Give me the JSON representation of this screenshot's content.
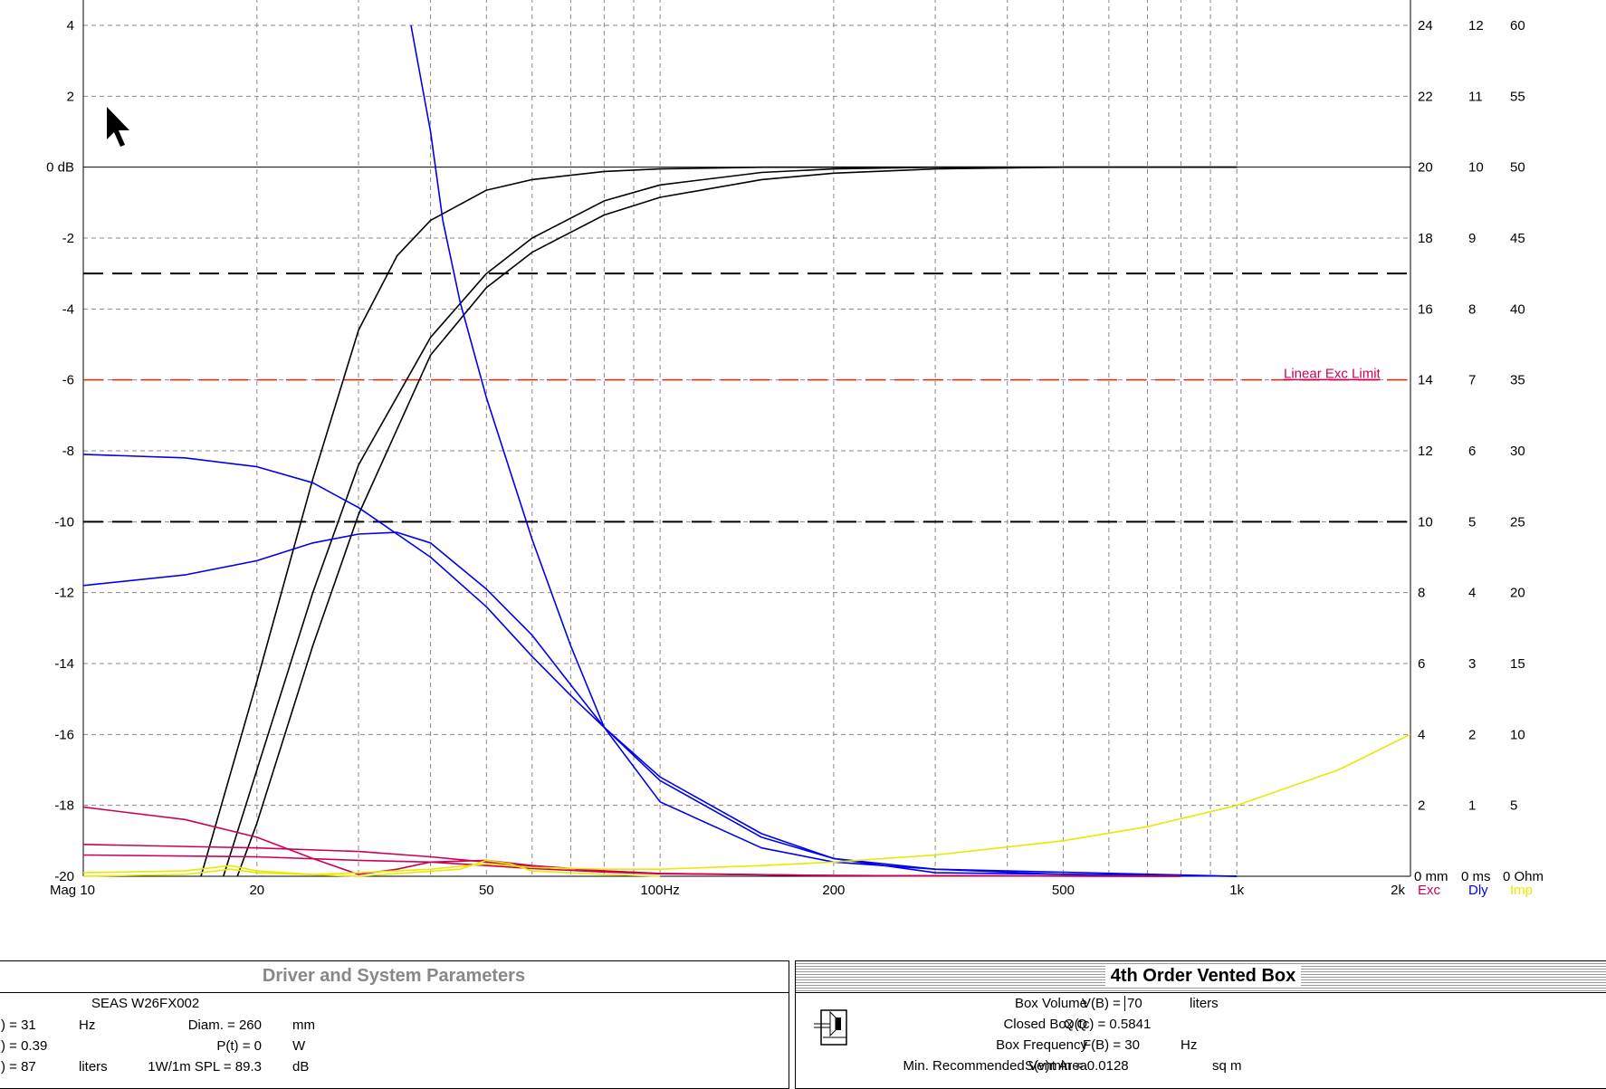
{
  "chart_data": {
    "type": "line",
    "xscale": "log",
    "xlim": [
      10,
      2000
    ],
    "x_ticks": [
      {
        "v": 10,
        "label": "Mag 10"
      },
      {
        "v": 20,
        "label": "20"
      },
      {
        "v": 50,
        "label": "50"
      },
      {
        "v": 100,
        "label": "100Hz"
      },
      {
        "v": 200,
        "label": "200"
      },
      {
        "v": 500,
        "label": "500"
      },
      {
        "v": 1000,
        "label": "1k"
      },
      {
        "v": 2000,
        "label": "2k"
      }
    ],
    "ylim": [
      -20,
      4
    ],
    "y_ticks": [
      {
        "v": 4,
        "label": "4"
      },
      {
        "v": 2,
        "label": "2"
      },
      {
        "v": 0,
        "label": "0 dB"
      },
      {
        "v": -2,
        "label": "-2"
      },
      {
        "v": -4,
        "label": "-4"
      },
      {
        "v": -6,
        "label": "-6"
      },
      {
        "v": -8,
        "label": "-8"
      },
      {
        "v": -10,
        "label": "-10"
      },
      {
        "v": -12,
        "label": "-12"
      },
      {
        "v": -14,
        "label": "-14"
      },
      {
        "v": -16,
        "label": "-16"
      },
      {
        "v": -18,
        "label": "-18"
      },
      {
        "v": -20,
        "label": "-20"
      }
    ],
    "right_axes": [
      {
        "name": "Exc",
        "unit": "mm",
        "color": "#cc0055",
        "labels": [
          "24",
          "22",
          "20",
          "18",
          "16",
          "14",
          "12",
          "10",
          "8",
          "6",
          "4",
          "2",
          "0 mm"
        ]
      },
      {
        "name": "Dly",
        "unit": "ms",
        "color": "#0000ee",
        "labels": [
          "12",
          "11",
          "10",
          "9",
          "8",
          "7",
          "6",
          "5",
          "4",
          "3",
          "2",
          "1",
          "0 ms"
        ]
      },
      {
        "name": "Imp",
        "unit": "Ohm",
        "color": "#e8e800",
        "labels": [
          "60",
          "55",
          "50",
          "45",
          "40",
          "35",
          "30",
          "25",
          "20",
          "15",
          "10",
          "5",
          "0 Ohm"
        ]
      }
    ],
    "reference_lines": [
      {
        "y": -3,
        "style": "dash",
        "color": "#000000"
      },
      {
        "y": -10,
        "style": "dash",
        "color": "#000000"
      },
      {
        "y": -6,
        "style": "dash",
        "color": "#ee2200",
        "label": "Linear Exc Limit"
      }
    ],
    "series": [
      {
        "kind": "magnitude",
        "color": "#000000",
        "points": [
          [
            16,
            -20
          ],
          [
            20,
            -14.5
          ],
          [
            25,
            -8.8
          ],
          [
            30,
            -4.6
          ],
          [
            35,
            -2.5
          ],
          [
            40,
            -1.5
          ],
          [
            50,
            -0.65
          ],
          [
            60,
            -0.35
          ],
          [
            80,
            -0.12
          ],
          [
            100,
            -0.05
          ],
          [
            150,
            0
          ],
          [
            1000,
            0
          ]
        ]
      },
      {
        "kind": "magnitude",
        "color": "#000000",
        "points": [
          [
            17.5,
            -20
          ],
          [
            20,
            -17
          ],
          [
            25,
            -12
          ],
          [
            30,
            -8.4
          ],
          [
            40,
            -4.8
          ],
          [
            50,
            -3.0
          ],
          [
            60,
            -2.0
          ],
          [
            80,
            -0.95
          ],
          [
            100,
            -0.5
          ],
          [
            150,
            -0.15
          ],
          [
            200,
            -0.05
          ],
          [
            300,
            0
          ],
          [
            1000,
            0
          ]
        ]
      },
      {
        "kind": "magnitude",
        "color": "#000000",
        "points": [
          [
            18.5,
            -20
          ],
          [
            20,
            -18.5
          ],
          [
            25,
            -13.5
          ],
          [
            30,
            -9.8
          ],
          [
            40,
            -5.3
          ],
          [
            50,
            -3.4
          ],
          [
            60,
            -2.4
          ],
          [
            80,
            -1.35
          ],
          [
            100,
            -0.85
          ],
          [
            150,
            -0.35
          ],
          [
            200,
            -0.17
          ],
          [
            300,
            -0.05
          ],
          [
            500,
            0
          ],
          [
            1000,
            0
          ]
        ]
      },
      {
        "kind": "group_delay",
        "color": "#0000ee",
        "points": [
          [
            37,
            4
          ],
          [
            40,
            1
          ],
          [
            42,
            -1.5
          ],
          [
            45,
            -3.8
          ],
          [
            50,
            -6.5
          ],
          [
            60,
            -10.5
          ],
          [
            70,
            -13.5
          ],
          [
            80,
            -15.8
          ],
          [
            100,
            -17.9
          ],
          [
            150,
            -19.2
          ],
          [
            200,
            -19.6
          ],
          [
            300,
            -19.8
          ],
          [
            500,
            -19.95
          ],
          [
            1000,
            -20
          ]
        ]
      },
      {
        "kind": "group_delay",
        "color": "#0000ee",
        "points": [
          [
            10,
            -8.1
          ],
          [
            15,
            -8.2
          ],
          [
            20,
            -8.45
          ],
          [
            25,
            -8.9
          ],
          [
            30,
            -9.6
          ],
          [
            40,
            -11.0
          ],
          [
            50,
            -12.4
          ],
          [
            60,
            -13.8
          ],
          [
            70,
            -14.9
          ],
          [
            80,
            -15.8
          ],
          [
            100,
            -17.2
          ],
          [
            150,
            -18.8
          ],
          [
            200,
            -19.5
          ],
          [
            300,
            -19.9
          ],
          [
            1000,
            -20
          ]
        ]
      },
      {
        "kind": "group_delay",
        "color": "#0000ee",
        "points": [
          [
            10,
            -11.8
          ],
          [
            15,
            -11.5
          ],
          [
            20,
            -11.1
          ],
          [
            25,
            -10.6
          ],
          [
            30,
            -10.35
          ],
          [
            35,
            -10.3
          ],
          [
            40,
            -10.6
          ],
          [
            50,
            -11.9
          ],
          [
            60,
            -13.2
          ],
          [
            70,
            -14.6
          ],
          [
            80,
            -15.8
          ],
          [
            100,
            -17.3
          ],
          [
            150,
            -18.9
          ],
          [
            200,
            -19.5
          ],
          [
            300,
            -19.8
          ],
          [
            1000,
            -20
          ]
        ]
      },
      {
        "kind": "excursion",
        "color": "#cc0055",
        "points": [
          [
            10,
            -18.05
          ],
          [
            15,
            -18.4
          ],
          [
            20,
            -18.9
          ],
          [
            25,
            -19.5
          ],
          [
            30,
            -19.95
          ],
          [
            35,
            -19.8
          ],
          [
            40,
            -19.6
          ],
          [
            50,
            -19.55
          ],
          [
            60,
            -19.7
          ],
          [
            80,
            -19.85
          ],
          [
            100,
            -19.92
          ],
          [
            200,
            -19.98
          ],
          [
            800,
            -20
          ]
        ]
      },
      {
        "kind": "excursion",
        "color": "#cc0055",
        "points": [
          [
            10,
            -19.1
          ],
          [
            20,
            -19.2
          ],
          [
            30,
            -19.3
          ],
          [
            40,
            -19.45
          ],
          [
            50,
            -19.6
          ],
          [
            60,
            -19.72
          ],
          [
            80,
            -19.85
          ],
          [
            100,
            -19.92
          ],
          [
            200,
            -19.98
          ],
          [
            800,
            -20
          ]
        ]
      },
      {
        "kind": "excursion",
        "color": "#cc0055",
        "points": [
          [
            10,
            -19.4
          ],
          [
            20,
            -19.45
          ],
          [
            30,
            -19.55
          ],
          [
            40,
            -19.6
          ],
          [
            50,
            -19.7
          ],
          [
            60,
            -19.78
          ],
          [
            80,
            -19.88
          ],
          [
            100,
            -19.93
          ],
          [
            200,
            -19.98
          ],
          [
            800,
            -20
          ]
        ]
      },
      {
        "kind": "impedance",
        "color": "#e8e800",
        "points": [
          [
            10,
            -19.9
          ],
          [
            15,
            -19.85
          ],
          [
            18,
            -19.7
          ],
          [
            20,
            -19.85
          ],
          [
            25,
            -19.95
          ],
          [
            30,
            -19.9
          ],
          [
            40,
            -19.8
          ],
          [
            50,
            -19.65
          ],
          [
            60,
            -19.75
          ],
          [
            80,
            -19.8
          ],
          [
            100,
            -19.8
          ],
          [
            150,
            -19.7
          ],
          [
            200,
            -19.6
          ],
          [
            300,
            -19.4
          ],
          [
            500,
            -19.0
          ],
          [
            700,
            -18.6
          ],
          [
            1000,
            -18.0
          ],
          [
            1500,
            -17.0
          ],
          [
            2000,
            -16.0
          ]
        ]
      },
      {
        "kind": "impedance",
        "color": "#e8e800",
        "points": [
          [
            10,
            -20
          ],
          [
            15,
            -19.95
          ],
          [
            18,
            -19.8
          ],
          [
            20,
            -19.9
          ],
          [
            30,
            -20
          ],
          [
            45,
            -19.8
          ],
          [
            50,
            -19.55
          ],
          [
            55,
            -19.65
          ],
          [
            60,
            -19.85
          ],
          [
            80,
            -19.95
          ],
          [
            100,
            -20
          ]
        ]
      }
    ]
  },
  "cursor_icon": "arrow-cursor-icon",
  "driver_panel": {
    "title": "Driver and System Parameters",
    "driver_name": "SEAS  W26FX002",
    "rows": [
      {
        "col1": ") = 31",
        "col1_unit": "Hz",
        "col2": "Diam. = 260",
        "col2_unit": "mm"
      },
      {
        "col1": ") = 0.39",
        "col1_unit": "",
        "col2": "P(t) = 0",
        "col2_unit": "W"
      },
      {
        "col1": ") = 87",
        "col1_unit": "liters",
        "col2": "1W/1m SPL = 89.3",
        "col2_unit": "dB"
      }
    ]
  },
  "box_panel": {
    "title": "4th Order Vented Box",
    "icon": "vented-box-speaker-icon",
    "rows": [
      {
        "label": "Box Volume",
        "symbol": "V(B) =",
        "value": "70",
        "unit": "liters",
        "editable": true
      },
      {
        "label": "Closed Box Q",
        "symbol": "Q(tc) = 0.5841",
        "value": "",
        "unit": "",
        "editable": false
      },
      {
        "label": "Box Frequency",
        "symbol": "F(B) = 30",
        "value": "",
        "unit": "Hz",
        "editable": false
      },
      {
        "label": "Min. Recommended Vent Area",
        "symbol": "S(v)min = 0.0128",
        "value": "",
        "unit": "sq m",
        "editable": false
      }
    ]
  }
}
